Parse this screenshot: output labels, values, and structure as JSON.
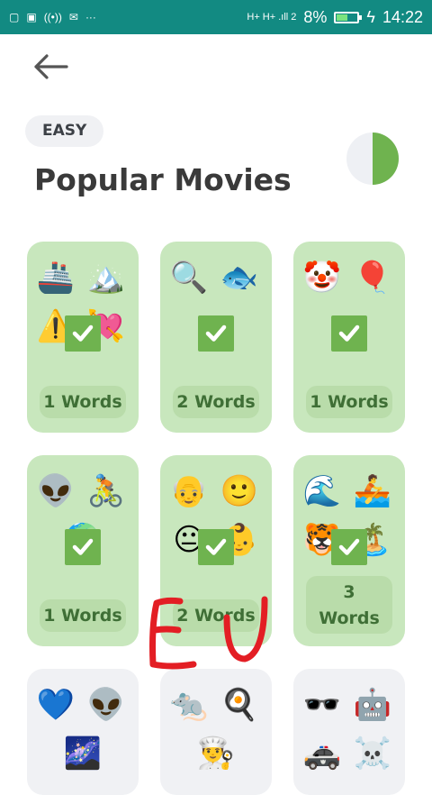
{
  "status_bar": {
    "signal_label": "H+ H+ .ıll 2",
    "battery_percent": "8%",
    "time": "14:22",
    "bg_color": "#128a82",
    "icons": [
      "sim-icon",
      "gallery-icon",
      "hotspot-icon",
      "mail-icon",
      "more-icon",
      "signal-icon",
      "battery-icon",
      "charging-icon"
    ]
  },
  "header": {
    "back_icon": "arrow-left-icon",
    "difficulty": "EASY",
    "title": "Popular Movies",
    "progress_fraction": 0.5
  },
  "colors": {
    "card_done": "#c8e7bd",
    "card_locked": "#f0f1f4",
    "check": "#6fb34f",
    "progress": "#6fb34f",
    "annotation": "#e31e24"
  },
  "annotation_text": "EU",
  "puzzles": [
    {
      "emojis": [
        "🚢",
        "🏔️",
        "⚠️",
        "💘"
      ],
      "words": "1 Words",
      "solved": true
    },
    {
      "emojis": [
        "🔍",
        "🐟"
      ],
      "words": "2 Words",
      "solved": true
    },
    {
      "emojis": [
        "🤡",
        "🎈"
      ],
      "words": "1 Words",
      "solved": true
    },
    {
      "emojis": [
        "👽",
        "🚴",
        "🌍"
      ],
      "words": "1 Words",
      "solved": true
    },
    {
      "emojis": [
        "👴",
        "🙂",
        "😐",
        "👶"
      ],
      "words": "2 Words",
      "solved": true
    },
    {
      "emojis": [
        "🌊",
        "🚣",
        "🐯",
        "🏝️"
      ],
      "words": "3 Words",
      "solved": true
    },
    {
      "emojis": [
        "💙",
        "👽",
        "🌌"
      ],
      "words": "",
      "solved": false
    },
    {
      "emojis": [
        "🐀",
        "🍳",
        "👨‍🍳"
      ],
      "words": "",
      "solved": false
    },
    {
      "emojis": [
        "🕶️",
        "🤖",
        "🚓",
        "☠️"
      ],
      "words": "",
      "solved": false
    }
  ]
}
